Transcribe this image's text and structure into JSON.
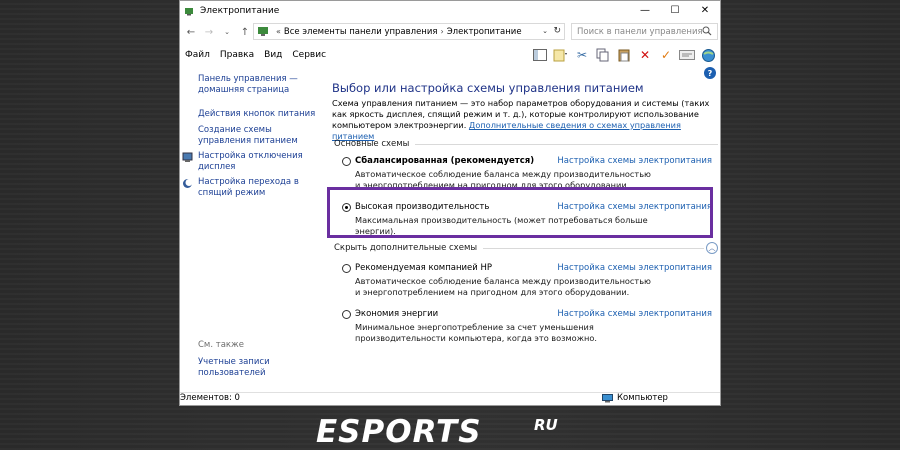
{
  "window": {
    "title": "Электропитание",
    "controls": {
      "minimize": "—",
      "maximize": "☐",
      "close": "✕"
    }
  },
  "address": {
    "prefix": "«",
    "crumb1": "Все элементы панели управления",
    "separator": "›",
    "crumb2": "Электропитание",
    "search_placeholder": "Поиск в панели управления"
  },
  "menu": [
    "Файл",
    "Правка",
    "Вид",
    "Сервис"
  ],
  "sidebar": {
    "items": [
      "Панель управления — домашняя страница",
      "Действия кнопок питания",
      "Создание схемы управления питанием",
      "Настройка отключения дисплея",
      "Настройка перехода в спящий режим"
    ],
    "see_also": "См. также",
    "see_also_items": [
      "Учетные записи пользователей"
    ]
  },
  "main": {
    "title": "Выбор или настройка схемы управления питанием",
    "description": "Схема управления питанием — это набор параметров оборудования и системы (таких как яркость дисплея, спящий режим и т. д.), которые контролируют использование компьютером электроэнергии. ",
    "description_link": "Дополнительные сведения о схемах управления питанием",
    "group1_title": "Основные схемы",
    "group2_title": "Скрыть дополнительные схемы",
    "plan_link_label": "Настройка схемы электропитания",
    "plans": [
      {
        "name": "Сбалансированная (рекомендуется)",
        "desc": "Автоматическое соблюдение баланса между производительностью и энергопотреблением на пригодном для этого оборудовании."
      },
      {
        "name": "Высокая производительность",
        "desc": "Максимальная производительность (может потребоваться больше энергии)."
      },
      {
        "name": "Рекомендуемая компанией HP",
        "desc": "Автоматическое соблюдение баланса между производительностью и энергопотреблением на пригодном для этого оборудовании."
      },
      {
        "name": "Экономия энергии",
        "desc": "Минимальное энергопотребление за счет уменьшения производительности компьютера, когда это возможно."
      }
    ],
    "selected_plan": "Высокая производительность"
  },
  "status": {
    "left": "Элементов: 0",
    "right": "Компьютер"
  },
  "watermark": "ESPORTS.RU",
  "colors": {
    "highlight": "#6a2fa0",
    "link": "#1c5fb0",
    "title": "#1e3287"
  }
}
